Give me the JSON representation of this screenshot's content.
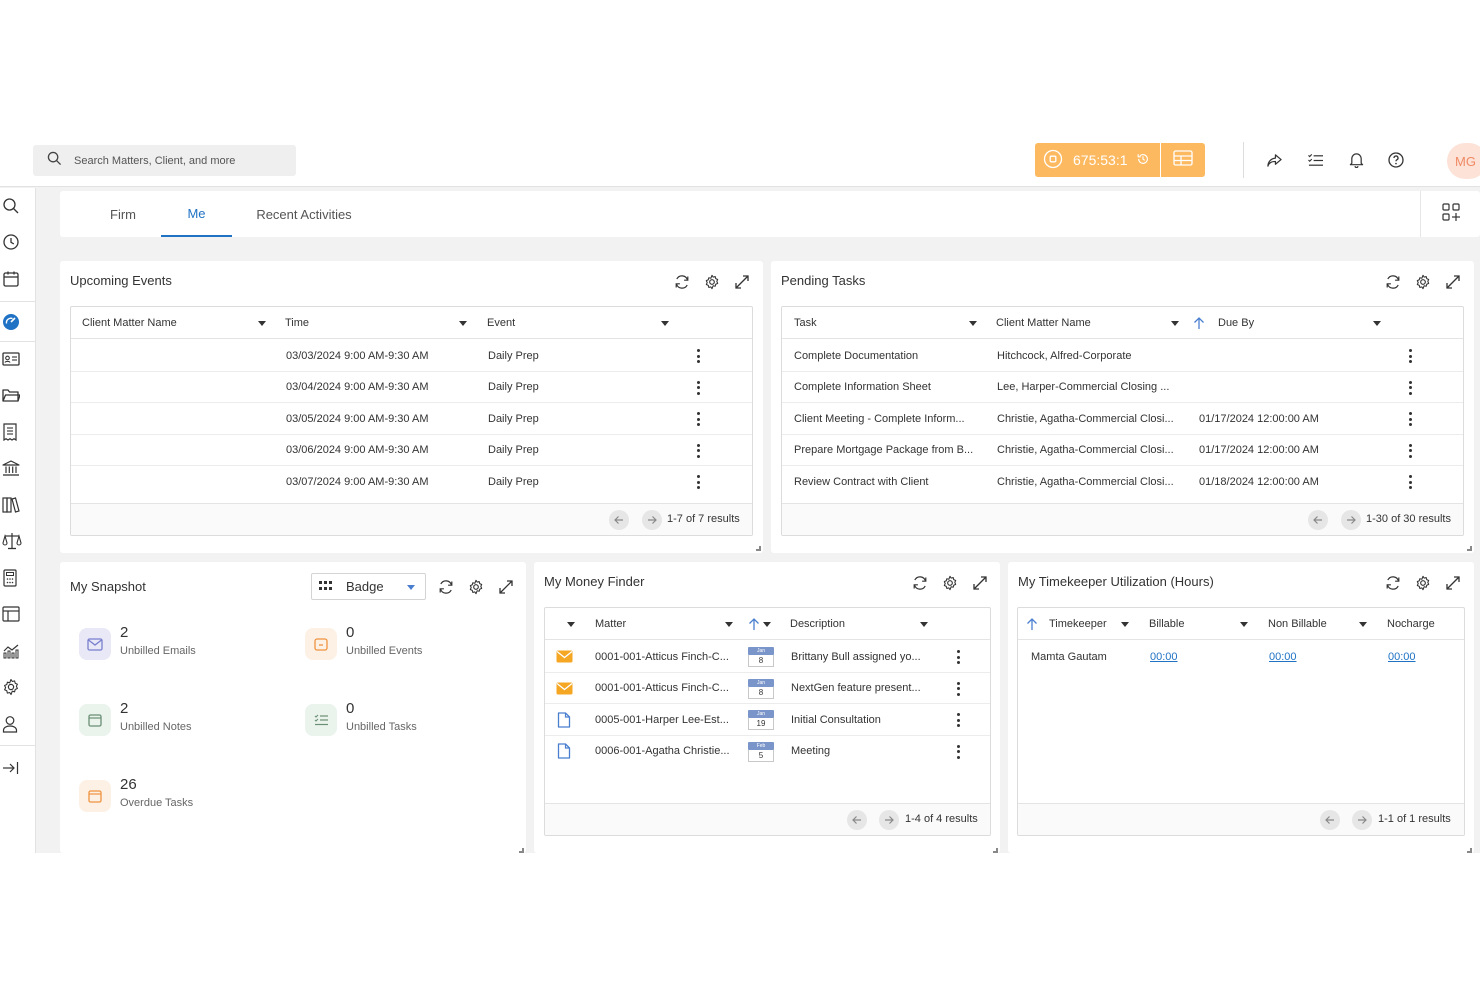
{
  "header": {
    "search_placeholder": "Search Matters, Client, and more",
    "timer_value": "675:53:1",
    "avatar_initials": "MG"
  },
  "tabs": [
    {
      "label": "Firm",
      "active": false
    },
    {
      "label": "Me",
      "active": true
    },
    {
      "label": "Recent Activities",
      "active": false
    }
  ],
  "upcoming_events": {
    "title": "Upcoming Events",
    "columns": [
      "Client Matter Name",
      "Time",
      "Event"
    ],
    "rows": [
      {
        "client": "",
        "time": "03/03/2024 9:00 AM-9:30 AM",
        "event": "Daily Prep"
      },
      {
        "client": "",
        "time": "03/04/2024 9:00 AM-9:30 AM",
        "event": "Daily Prep"
      },
      {
        "client": "",
        "time": "03/05/2024 9:00 AM-9:30 AM",
        "event": "Daily Prep"
      },
      {
        "client": "",
        "time": "03/06/2024 9:00 AM-9:30 AM",
        "event": "Daily Prep"
      },
      {
        "client": "",
        "time": "03/07/2024 9:00 AM-9:30 AM",
        "event": "Daily Prep"
      }
    ],
    "results": "1-7 of 7 results"
  },
  "pending_tasks": {
    "title": "Pending Tasks",
    "columns": [
      "Task",
      "Client Matter Name",
      "Due By"
    ],
    "rows": [
      {
        "task": "Complete Documentation",
        "client": "Hitchcock, Alfred-Corporate",
        "due": ""
      },
      {
        "task": "Complete Information Sheet",
        "client": "Lee, Harper-Commercial Closing ...",
        "due": ""
      },
      {
        "task": "Client Meeting - Complete Inform...",
        "client": "Christie, Agatha-Commercial Closi...",
        "due": "01/17/2024 12:00:00 AM"
      },
      {
        "task": "Prepare Mortgage Package from B...",
        "client": "Christie, Agatha-Commercial Closi...",
        "due": "01/17/2024 12:00:00 AM"
      },
      {
        "task": "Review Contract with Client",
        "client": "Christie, Agatha-Commercial Closi...",
        "due": "01/18/2024 12:00:00 AM"
      }
    ],
    "results": "1-30 of 30 results"
  },
  "my_snapshot": {
    "title": "My Snapshot",
    "view_select": "Badge",
    "items": [
      {
        "count": "2",
        "label": "Unbilled Emails",
        "color": "#e8e8f7"
      },
      {
        "count": "0",
        "label": "Unbilled Events",
        "color": "#fdf1e6"
      },
      {
        "count": "2",
        "label": "Unbilled Notes",
        "color": "#eaf3ec"
      },
      {
        "count": "0",
        "label": "Unbilled Tasks",
        "color": "#eaf3ec"
      },
      {
        "count": "26",
        "label": "Overdue Tasks",
        "color": "#fdf1e6"
      }
    ]
  },
  "money_finder": {
    "title": "My Money Finder",
    "columns": [
      "Matter",
      "Description"
    ],
    "rows": [
      {
        "type": "email",
        "matter": "0001-001-Atticus Finch-C...",
        "month": "Jan",
        "day": "8",
        "desc": "Brittany Bull assigned yo..."
      },
      {
        "type": "email",
        "matter": "0001-001-Atticus Finch-C...",
        "month": "Jan",
        "day": "8",
        "desc": "NextGen feature present..."
      },
      {
        "type": "doc",
        "matter": "0005-001-Harper Lee-Est...",
        "month": "Jan",
        "day": "19",
        "desc": "Initial Consultation"
      },
      {
        "type": "doc",
        "matter": "0006-001-Agatha Christie...",
        "month": "Feb",
        "day": "5",
        "desc": "Meeting"
      }
    ],
    "results": "1-4 of 4 results"
  },
  "timekeeper": {
    "title": "My Timekeeper Utilization (Hours)",
    "columns": [
      "Timekeeper",
      "Billable",
      "Non Billable",
      "Nocharge"
    ],
    "rows": [
      {
        "name": "Mamta Gautam",
        "billable": "00:00",
        "non_billable": "00:00",
        "nocharge": "00:00"
      }
    ],
    "results": "1-1 of 1 results"
  },
  "colors": {
    "accent": "#1f72c4",
    "timer": "#fdb95f",
    "email_icon": "#f5a623",
    "doc_icon": "#4a7fd0"
  }
}
